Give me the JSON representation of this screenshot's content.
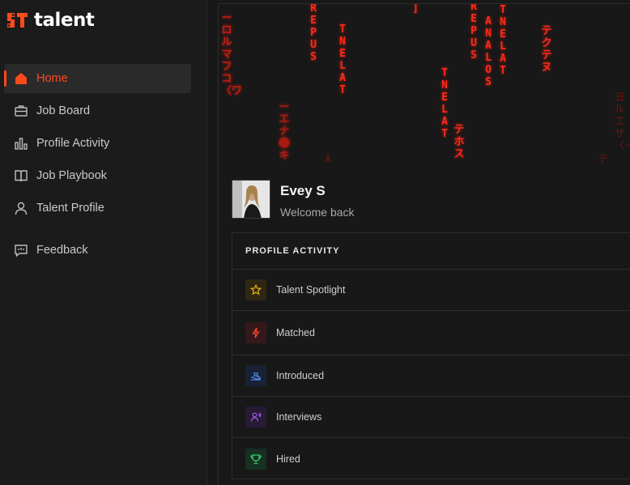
{
  "brand": {
    "name": "talent",
    "accent": "#ff4a1c"
  },
  "nav": {
    "items": [
      {
        "label": "Home",
        "icon": "home-icon",
        "active": true
      },
      {
        "label": "Job Board",
        "icon": "briefcase-icon"
      },
      {
        "label": "Profile Activity",
        "icon": "bar-chart-icon"
      },
      {
        "label": "Job Playbook",
        "icon": "book-icon"
      },
      {
        "label": "Talent Profile",
        "icon": "user-icon"
      }
    ],
    "feedback": {
      "label": "Feedback",
      "icon": "feedback-icon"
    }
  },
  "banner": {
    "columns": [
      {
        "text": "ーロルマフコ〈ワ",
        "dim": false
      },
      {
        "text": "ーエナ❶キ",
        "dim": false
      },
      {
        "text": "REPUS",
        "dim": false
      },
      {
        "text": "A",
        "dim": true
      },
      {
        "text": "TNELAT",
        "dim": false
      },
      {
        "text": "]",
        "dim": false
      },
      {
        "text": "TNELAT",
        "dim": false
      },
      {
        "text": "テホス",
        "dim": false
      },
      {
        "text": "REPUS",
        "dim": false
      },
      {
        "text": "ANALOS",
        "dim": false
      },
      {
        "text": "TNELAT",
        "dim": false
      },
      {
        "text": "テクテヌ",
        "dim": false
      },
      {
        "text": "ヨルエサ〈イ",
        "dim": true
      },
      {
        "text": "テ",
        "dim": true
      }
    ]
  },
  "welcome": {
    "name": "Evey S",
    "subtitle": "Welcome back",
    "avatar_icon": "profile-photo"
  },
  "activity": {
    "title": "PROFILE ACTIVITY",
    "rows": [
      {
        "label": "Talent Spotlight",
        "icon": "star-icon",
        "color": "#e8b21b",
        "bg": "#2f2712"
      },
      {
        "label": "Matched",
        "icon": "bolt-icon",
        "color": "#ff4a2a",
        "bg": "#34181a"
      },
      {
        "label": "Introduced",
        "icon": "handshake-icon",
        "color": "#4c8df5",
        "bg": "#182234"
      },
      {
        "label": "Interviews",
        "icon": "interview-icon",
        "color": "#a35df0",
        "bg": "#261a34"
      },
      {
        "label": "Hired",
        "icon": "trophy-icon",
        "color": "#38c96a",
        "bg": "#163021"
      }
    ]
  }
}
